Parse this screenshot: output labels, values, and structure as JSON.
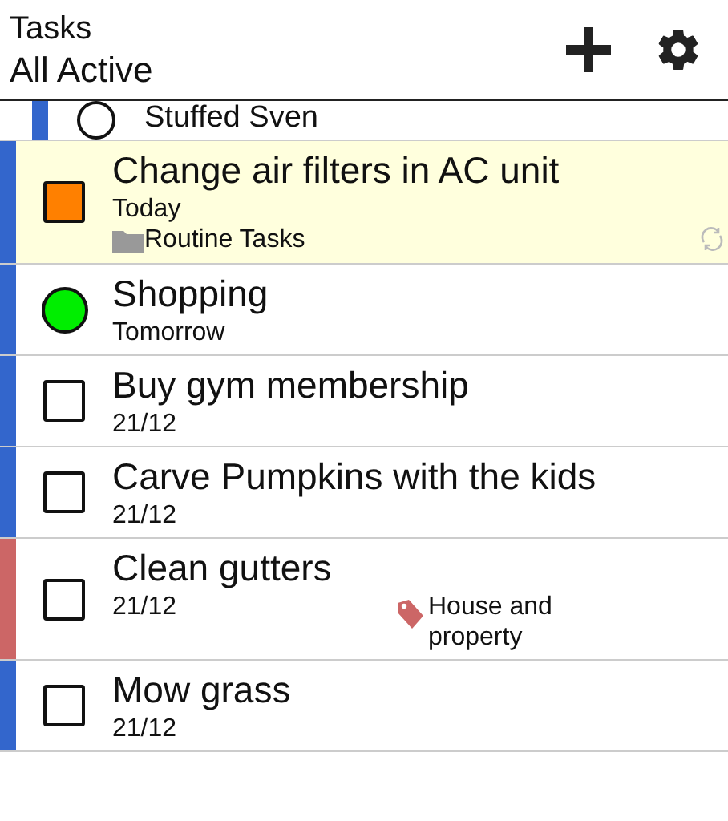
{
  "header": {
    "title": "Tasks",
    "subtitle": "All Active"
  },
  "tasks": [
    {
      "title": "Stuffed Sven",
      "checkbox": {
        "kind": "circle"
      },
      "list": {
        "color": "#3366cc"
      },
      "subtask": true,
      "highlighted": false,
      "repeating": false
    },
    {
      "title": "Change air filters in AC unit",
      "date": "Today",
      "project": "Routine Tasks",
      "checkbox": {
        "kind": "square",
        "color": "#ff8000"
      },
      "list": {
        "color": "#3366cc"
      },
      "subtask": false,
      "highlighted": true,
      "repeating": true
    },
    {
      "title": "Shopping",
      "date": "Tomorrow",
      "checkbox": {
        "kind": "circle",
        "color": "#00ee00"
      },
      "list": {
        "color": "#3366cc"
      },
      "subtask": false,
      "highlighted": false,
      "repeating": false
    },
    {
      "title": "Buy gym membership",
      "date": "21/12",
      "checkbox": {
        "kind": "square"
      },
      "list": {
        "color": "#3366cc"
      },
      "subtask": false,
      "highlighted": false,
      "repeating": false
    },
    {
      "title": "Carve Pumpkins with the kids",
      "date": "21/12",
      "checkbox": {
        "kind": "square"
      },
      "list": {
        "color": "#3366cc"
      },
      "subtask": false,
      "highlighted": false,
      "repeating": false
    },
    {
      "title": "Clean gutters",
      "date": "21/12",
      "tag": "House and property",
      "checkbox": {
        "kind": "square"
      },
      "list": {
        "color": "#cc6666"
      },
      "subtask": false,
      "highlighted": false,
      "repeating": false
    },
    {
      "title": "Mow grass",
      "date": "21/12",
      "checkbox": {
        "kind": "square"
      },
      "list": {
        "color": "#3366cc"
      },
      "subtask": false,
      "highlighted": false,
      "repeating": false
    }
  ]
}
